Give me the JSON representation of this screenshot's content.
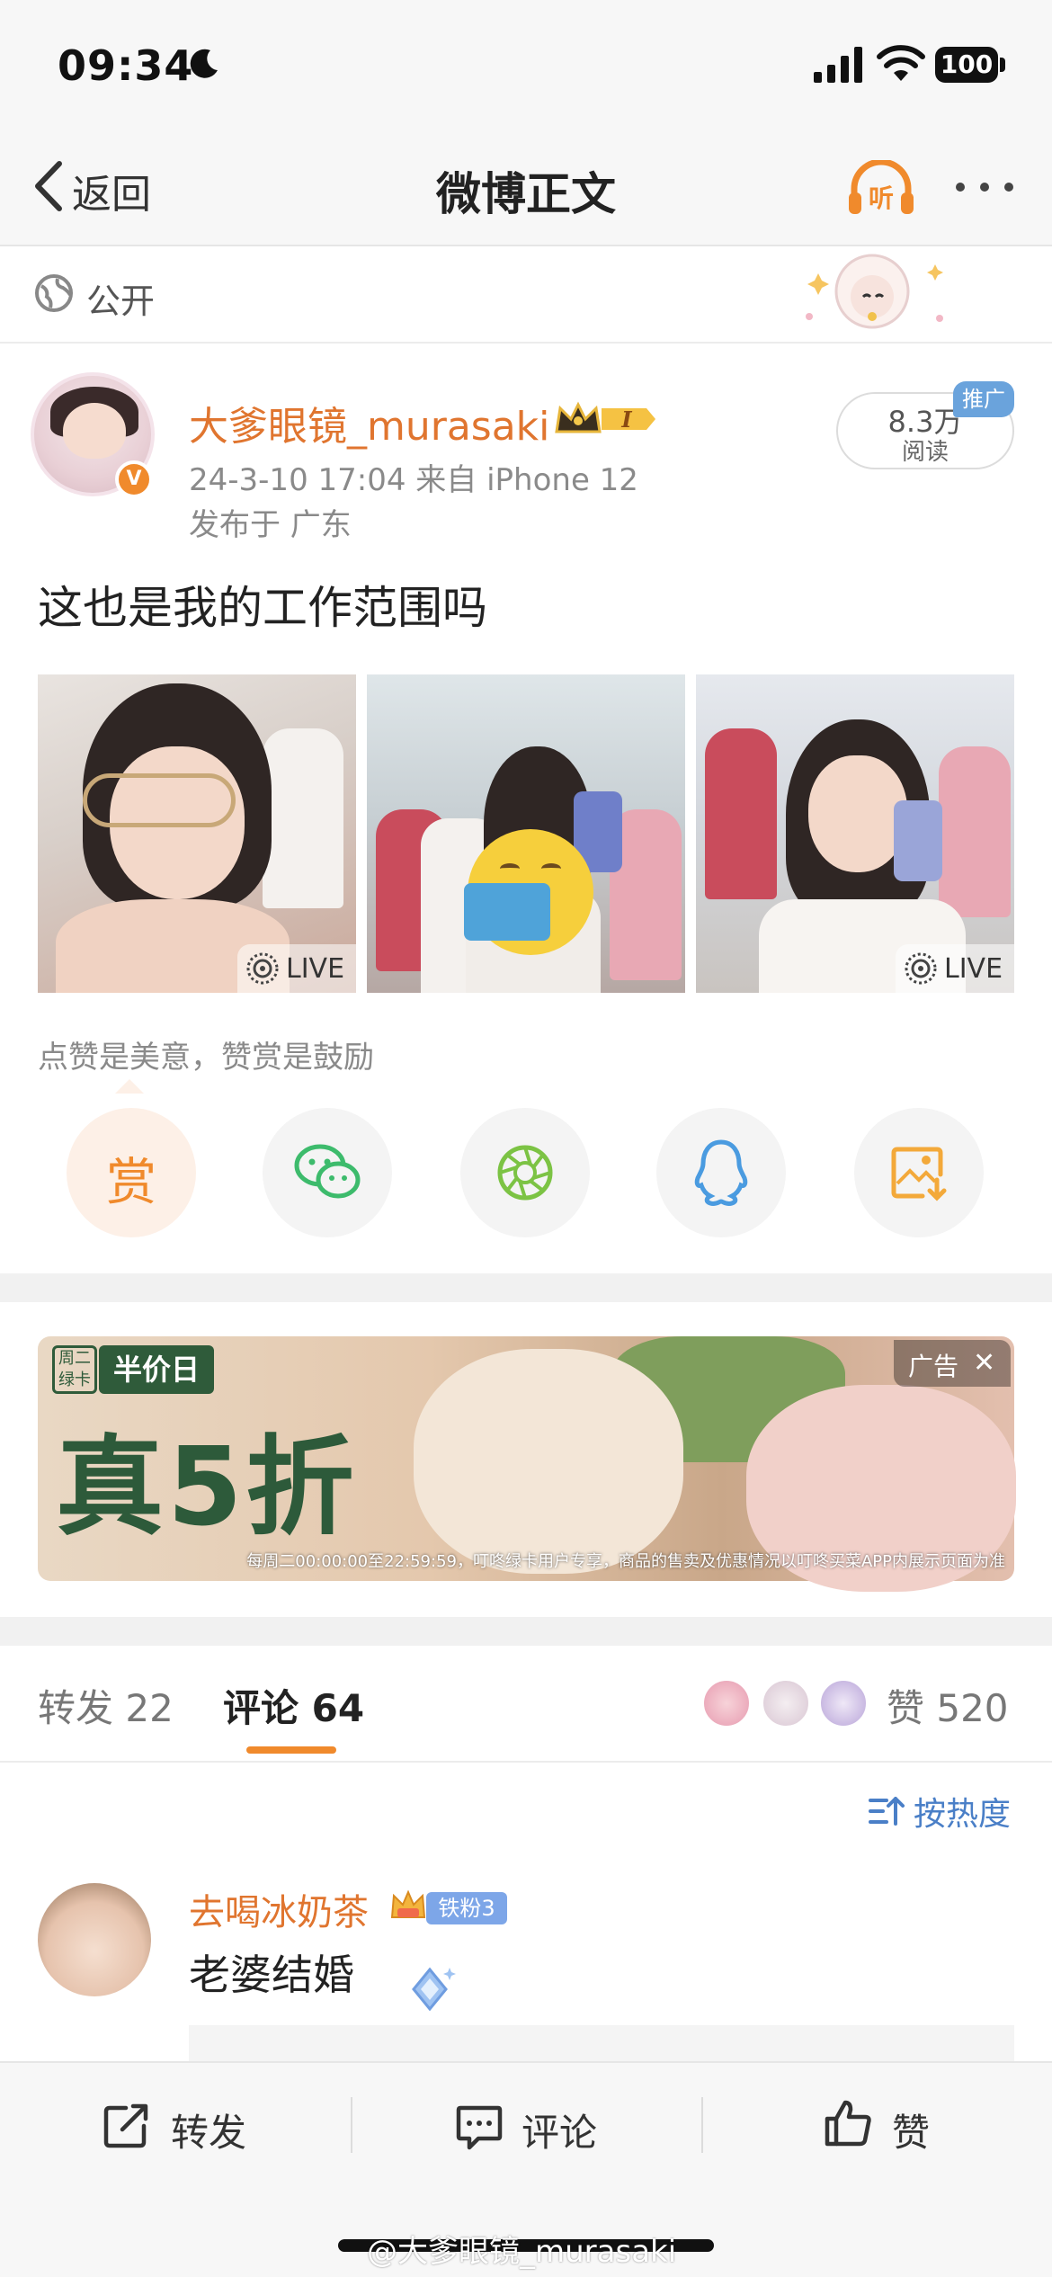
{
  "status_bar": {
    "time": "09:34",
    "battery": "100"
  },
  "nav": {
    "back_label": "返回",
    "title": "微博正文",
    "listen_label": "听"
  },
  "visibility": {
    "label": "公开"
  },
  "post": {
    "username": "大爹眼镜_murasaki",
    "member_level": "I",
    "verified_mark": "V",
    "time_source": "24-3-10 17:04  来自 iPhone 12",
    "location": "发布于 广东",
    "reads_count": "8.3万",
    "reads_label": "阅读",
    "promo_tag": "推广",
    "text": "这也是我的工作范围吗",
    "photos": [
      {
        "live": "LIVE"
      },
      {
        "live": ""
      },
      {
        "live": "LIVE"
      }
    ],
    "like_tip": "点赞是美意，赞赏是鼓励",
    "reward_label": "赏"
  },
  "share": {
    "items": [
      "reward",
      "wechat",
      "moments",
      "qq",
      "save-image"
    ],
    "colors": {
      "wechat": "#3dbb6c",
      "moments": "#7cc344",
      "qq": "#4a9be0",
      "save": "#f3a93a",
      "reward": "#f08a2c"
    }
  },
  "ad": {
    "card_tag": "周二\n绿卡",
    "half_price": "半价日",
    "headline": "真5折",
    "disclaimer": "每周二00:00:00至22:59:59，叮咚绿卡用户专享，商品的售卖及优惠情况以叮咚买菜APP内展示页面为准",
    "label": "广告",
    "close": "✕"
  },
  "tabs": {
    "repost": "转发 22",
    "comment": "评论 64",
    "like": "赞 520"
  },
  "sort": {
    "label": "按热度"
  },
  "comment": {
    "name": "去喝冰奶茶",
    "fan_badge": "铁粉3",
    "text": "老婆结婚"
  },
  "bottom_bar": {
    "repost": "转发",
    "comment": "评论",
    "like": "赞"
  },
  "watermark": "@大爹眼镜_murasaki",
  "colors": {
    "accent": "#e0752f",
    "link": "#4a7fc7",
    "promo": "#6aa3dc"
  }
}
